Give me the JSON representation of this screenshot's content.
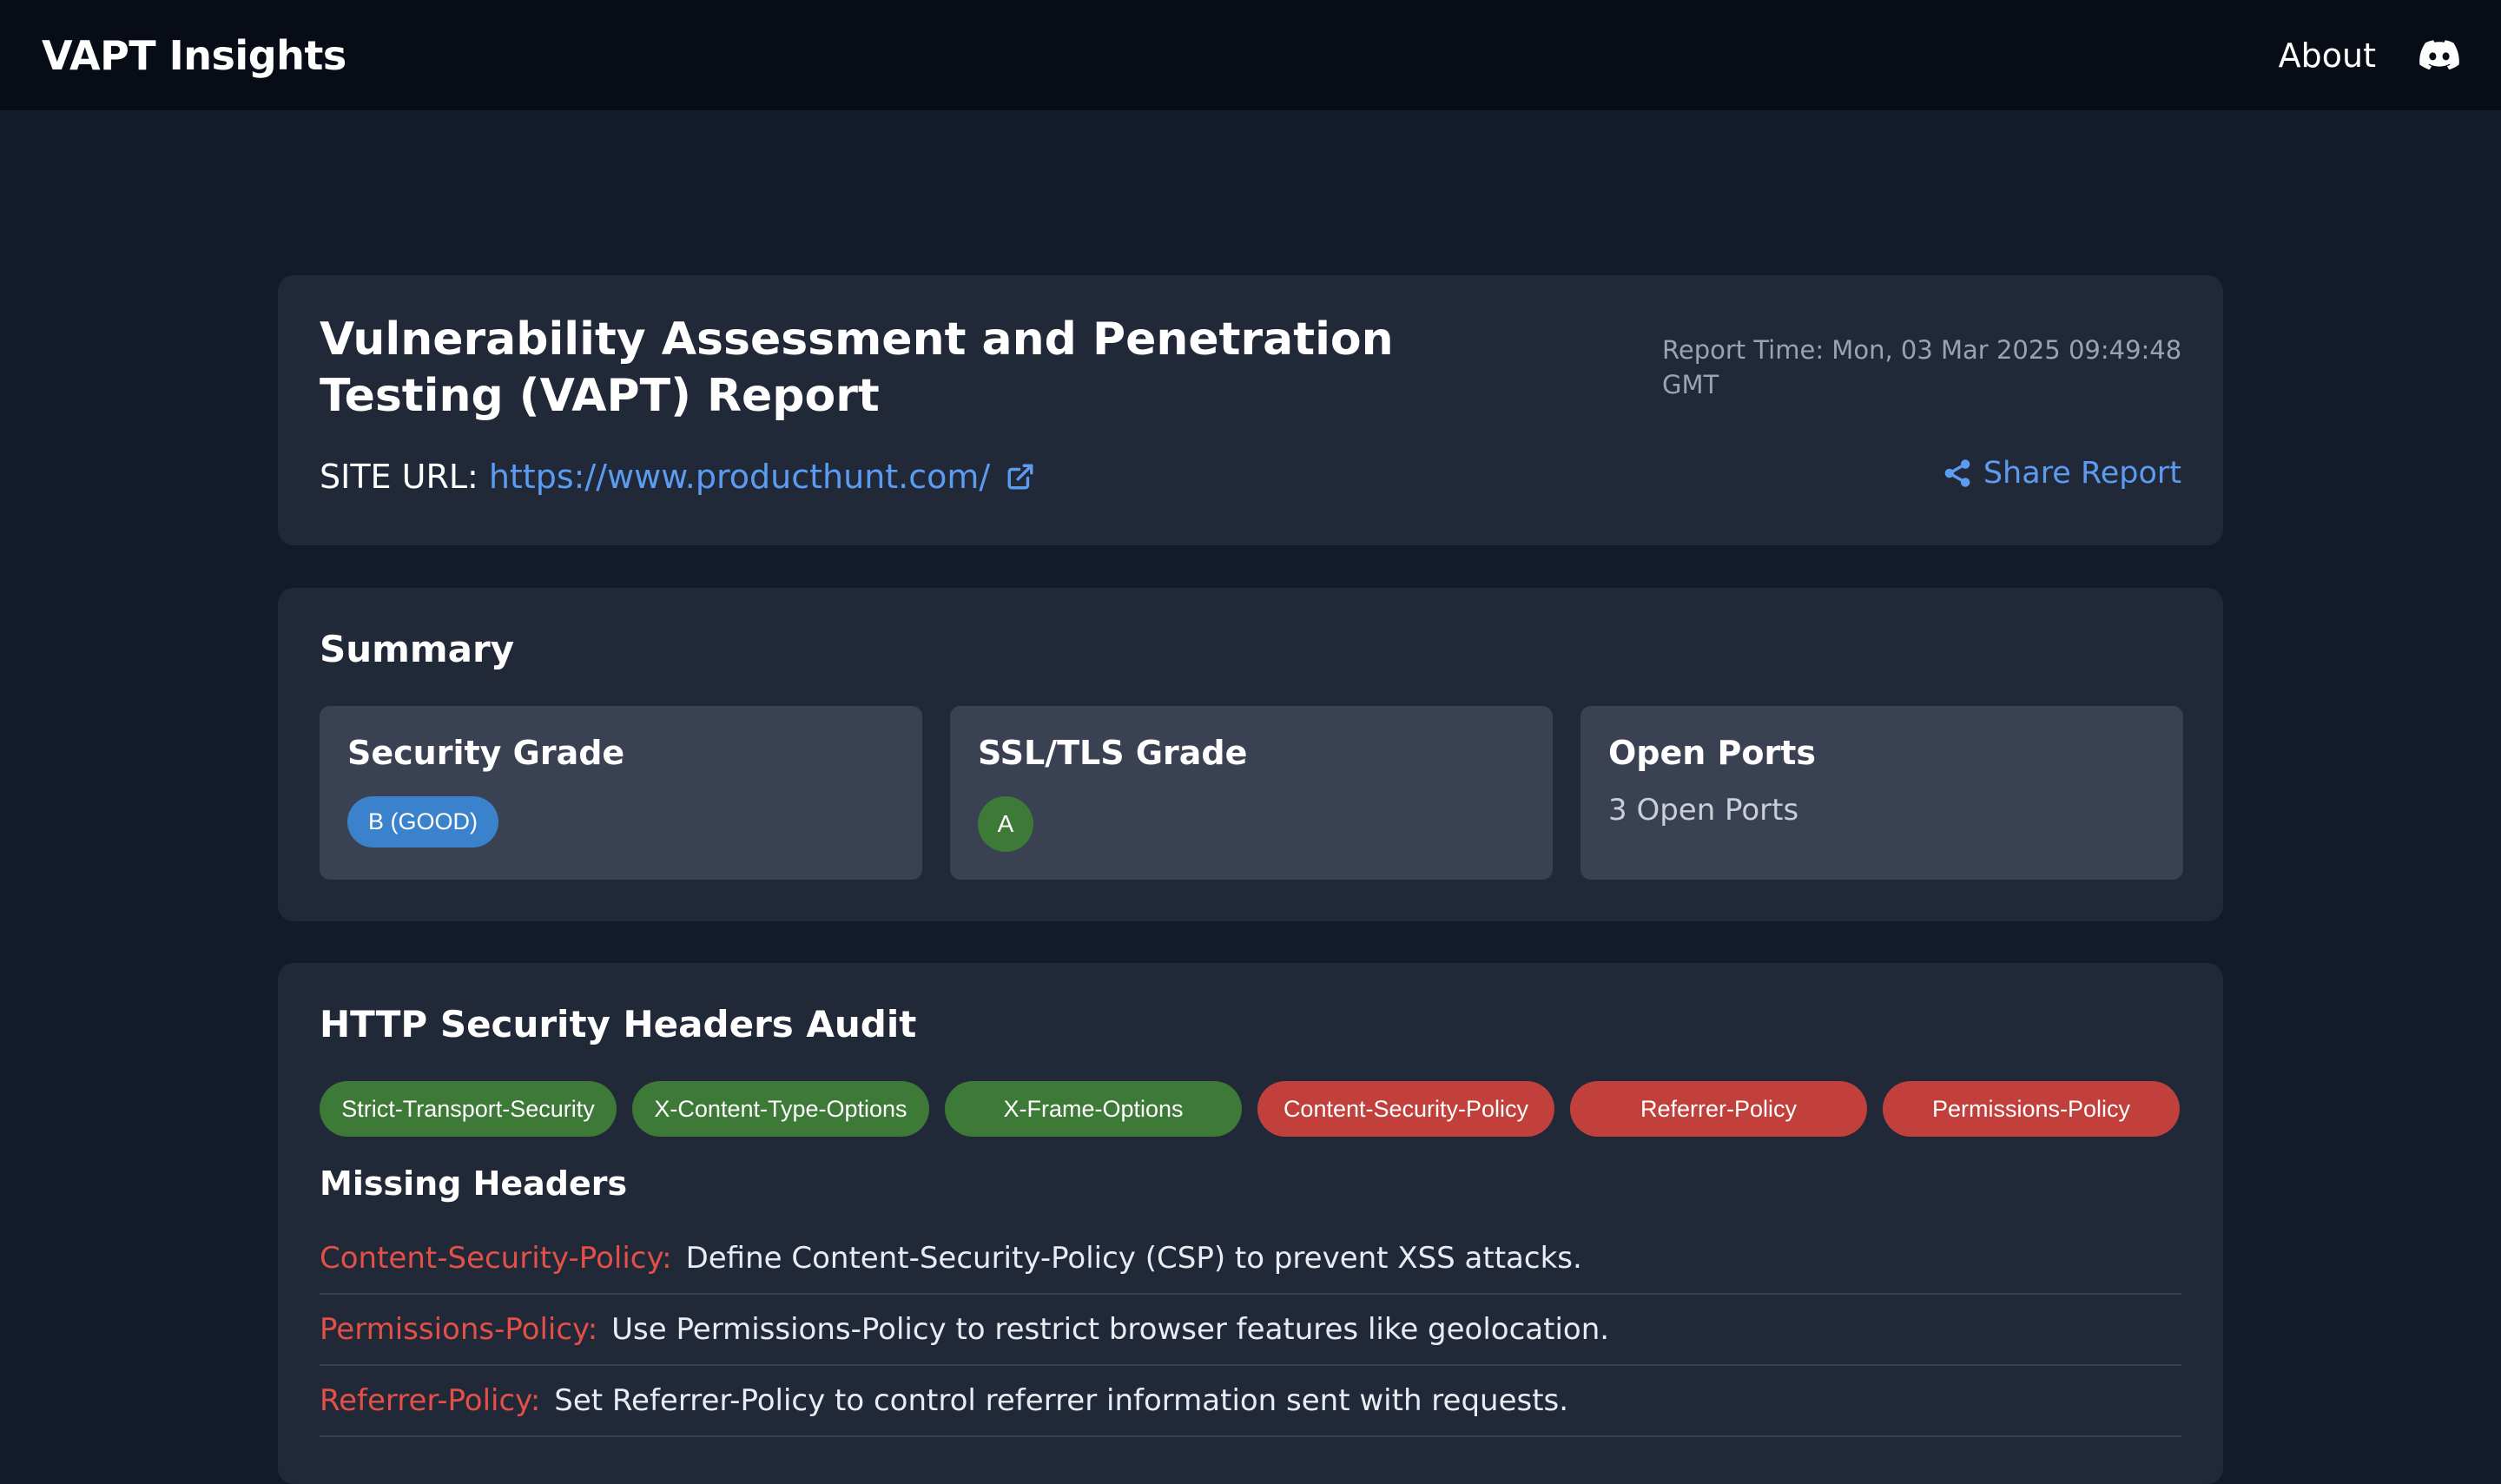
{
  "topbar": {
    "brand": "VAPT Insights",
    "about": "About",
    "discord_icon": "discord-icon"
  },
  "report": {
    "title": "Vulnerability Assessment and Penetration Testing (VAPT) Report",
    "time": "Report Time: Mon, 03 Mar 2025 09:49:48 GMT",
    "site_label": "SITE URL:",
    "site_url": "https://www.producthunt.com/",
    "share_label": "Share Report"
  },
  "summary": {
    "title": "Summary",
    "security": {
      "label": "Security Grade",
      "value": "B (GOOD)"
    },
    "ssl": {
      "label": "SSL/TLS Grade",
      "value": "A"
    },
    "ports": {
      "label": "Open Ports",
      "value": "3 Open Ports"
    }
  },
  "headers_audit": {
    "title": "HTTP Security Headers Audit",
    "chips": [
      {
        "name": "Strict-Transport-Security",
        "status": "present"
      },
      {
        "name": "X-Content-Type-Options",
        "status": "present"
      },
      {
        "name": "X-Frame-Options",
        "status": "present"
      },
      {
        "name": "Content-Security-Policy",
        "status": "missing"
      },
      {
        "name": "Referrer-Policy",
        "status": "missing"
      },
      {
        "name": "Permissions-Policy",
        "status": "missing"
      }
    ],
    "missing_title": "Missing Headers",
    "missing": [
      {
        "name": "Content-Security-Policy:",
        "desc": "Define Content-Security-Policy (CSP) to prevent XSS attacks."
      },
      {
        "name": "Permissions-Policy:",
        "desc": "Use Permissions-Policy to restrict browser features like geolocation."
      },
      {
        "name": "Referrer-Policy:",
        "desc": "Set Referrer-Policy to control referrer information sent with requests."
      }
    ]
  },
  "colors": {
    "accent_blue": "#5b9cf0",
    "present_green": "#3e7a37",
    "missing_red": "#c2403b"
  }
}
